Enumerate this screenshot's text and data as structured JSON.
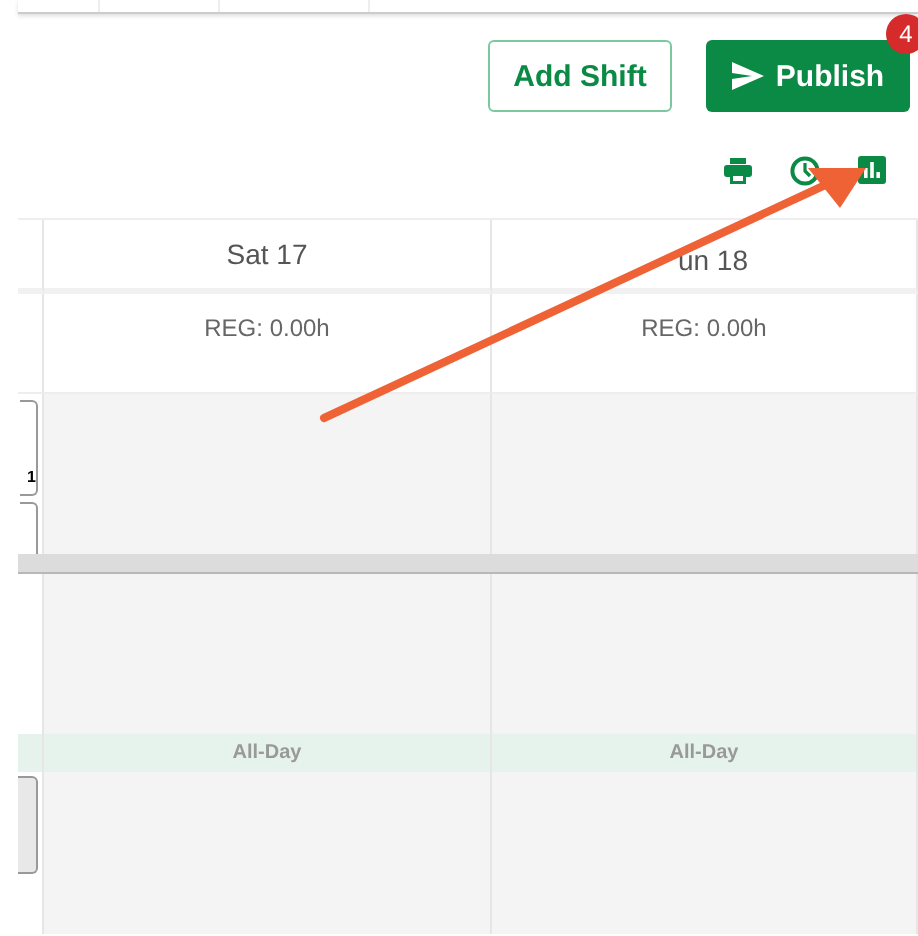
{
  "toolbar": {
    "add_shift": "Add Shift",
    "publish": "Publish",
    "publish_badge": "4"
  },
  "days": [
    {
      "label": "Sat 17",
      "hours": "REG: 0.00h",
      "all_day": "All-Day"
    },
    {
      "label": "un 18",
      "hours": "REG: 0.00h",
      "all_day": "All-Day"
    }
  ],
  "side_card_count": "1"
}
